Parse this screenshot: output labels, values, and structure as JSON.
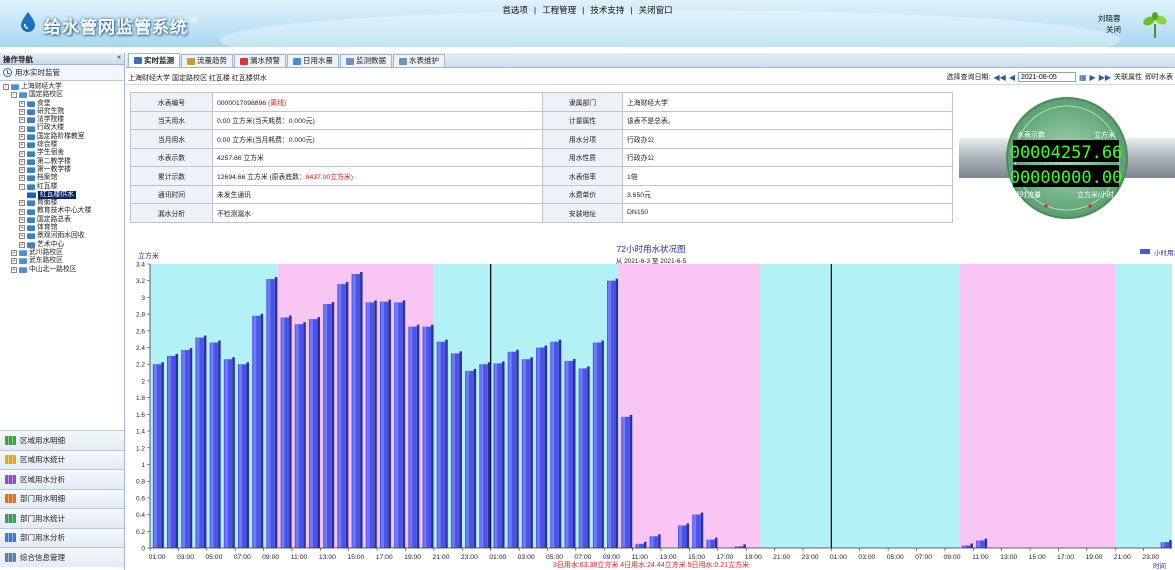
{
  "header": {
    "title": "给水管网监管系统",
    "subtitle": "v2011版",
    "user": "刘晓蓉",
    "logout": "关闭",
    "nav": [
      "首选项",
      "工程管理",
      "技术支持",
      "关闭窗口"
    ],
    "nav_sep": "|"
  },
  "sidebar": {
    "title": "操作导航",
    "collapse": "«",
    "monitor": "用水实时监管",
    "tree": [
      {
        "label": "上海财经大学",
        "level": 0,
        "pm": "⊟",
        "folder": "b"
      },
      {
        "label": "国定路校区",
        "level": 1,
        "pm": "⊟",
        "folder": "b"
      },
      {
        "label": "食堂",
        "level": 2,
        "pm": "⊞",
        "folder": "f"
      },
      {
        "label": "研究生院",
        "level": 2,
        "pm": "⊞",
        "folder": "f"
      },
      {
        "label": "法学院楼",
        "level": 2,
        "pm": "⊞",
        "folder": "f"
      },
      {
        "label": "行政大楼",
        "level": 2,
        "pm": "⊞",
        "folder": "f"
      },
      {
        "label": "国定路阶梯教室",
        "level": 2,
        "pm": "⊞",
        "folder": "f"
      },
      {
        "label": "综合楼",
        "level": 2,
        "pm": "⊞",
        "folder": "f"
      },
      {
        "label": "学生宿舍",
        "level": 2,
        "pm": "⊞",
        "folder": "f"
      },
      {
        "label": "第二教学楼",
        "level": 2,
        "pm": "⊞",
        "folder": "f"
      },
      {
        "label": "第一教学楼",
        "level": 2,
        "pm": "⊞",
        "folder": "f"
      },
      {
        "label": "档案馆",
        "level": 2,
        "pm": "⊞",
        "folder": "f"
      },
      {
        "label": "红瓦楼",
        "level": 2,
        "pm": "⊟",
        "folder": "f"
      },
      {
        "label": "红瓦楼供水",
        "level": 3,
        "pm": "",
        "folder": "m",
        "selected": true
      },
      {
        "label": "育衡楼",
        "level": 2,
        "pm": "⊞",
        "folder": "f"
      },
      {
        "label": "教育技术中心大楼",
        "level": 2,
        "pm": "⊞",
        "folder": "f"
      },
      {
        "label": "国定路总表",
        "level": 2,
        "pm": "⊞",
        "folder": "f"
      },
      {
        "label": "体育馆",
        "level": 2,
        "pm": "⊞",
        "folder": "f"
      },
      {
        "label": "景观河雨水回收",
        "level": 2,
        "pm": "⊞",
        "folder": "f"
      },
      {
        "label": "艺术中心",
        "level": 2,
        "pm": "⊞",
        "folder": "f"
      },
      {
        "label": "武川路校区",
        "level": 1,
        "pm": "⊞",
        "folder": "b"
      },
      {
        "label": "武东路校区",
        "level": 1,
        "pm": "⊞",
        "folder": "b"
      },
      {
        "label": "中山北一路校区",
        "level": 1,
        "pm": "⊞",
        "folder": "b"
      }
    ],
    "menu": [
      {
        "label": "区域用水明细",
        "icon": "bar-chart-green-icon",
        "color": "#3aa43a"
      },
      {
        "label": "区域用水统计",
        "icon": "bar-chart-yellow-icon",
        "color": "#e2a81a"
      },
      {
        "label": "区域用水分析",
        "icon": "bar-chart-purple-icon",
        "color": "#8a4fc4"
      },
      {
        "label": "部门用水明细",
        "icon": "org-orange-icon",
        "color": "#e07020"
      },
      {
        "label": "部门用水统计",
        "icon": "org-green-icon",
        "color": "#3a9a5a"
      },
      {
        "label": "部门用水分析",
        "icon": "org-blue-icon",
        "color": "#3a7ad0"
      },
      {
        "label": "综合信息管理",
        "icon": "document-icon",
        "color": "#5a7ab0"
      }
    ]
  },
  "tabs": [
    {
      "label": "实时监测",
      "icon": "monitor-icon",
      "color": "#3b6fb8",
      "active": true
    },
    {
      "label": "流量趋势",
      "icon": "trend-icon",
      "color": "#c8a030"
    },
    {
      "label": "漏水预警",
      "icon": "alert-icon",
      "color": "#e03030"
    },
    {
      "label": "日用水量",
      "icon": "calendar-icon",
      "color": "#4a8ad8"
    },
    {
      "label": "监测数据",
      "icon": "pencil-icon",
      "color": "#6a90c0"
    },
    {
      "label": "水表维护",
      "icon": "wrench-icon",
      "color": "#7090b0"
    }
  ],
  "breadcrumb": "上海财经大学 国定路校区 红瓦楼 红瓦楼供水",
  "query": {
    "label": "选择查询日期:",
    "date": "2021-06-05",
    "first": "◀◀",
    "prev": "◀",
    "next": "▶",
    "last": "▶▶",
    "related": "关联属性",
    "refresh": "即时水表"
  },
  "info": {
    "rows": [
      {
        "l1": "水表编号",
        "v1a": "0000017098896 ",
        "v1b": "(离线)",
        "l2": "隶属部门",
        "v2": "上海财经大学"
      },
      {
        "l1": "当天用水",
        "v1a": "0.00 立方米(当天耗费：0.000元)",
        "v1b": "",
        "l2": "计量属性",
        "v2": "该表不是总表。"
      },
      {
        "l1": "当月用水",
        "v1a": "0.00 立方米(当月耗费：0.000元)",
        "v1b": "",
        "l2": "用水分项",
        "v2": "行政办公"
      },
      {
        "l1": "水表示数",
        "v1a": "4257.66 立方米",
        "v1b": "",
        "l2": "用水性质",
        "v2": "行政办公"
      },
      {
        "l1": "累计示数",
        "v1a": "12694.66 立方米 (原表底数：",
        "v1b": "8437.00立方米)",
        "l2": "水表倍率",
        "v2": "1倍"
      },
      {
        "l1": "通讯时间",
        "v1a": "未发生通讯",
        "v1b": "",
        "l2": "水费单价",
        "v2": "3.650元"
      },
      {
        "l1": "漏水分析",
        "v1a": "不检测漏水",
        "v1b": "",
        "l2": "安装地址",
        "v2": "DN150"
      }
    ]
  },
  "meter": {
    "reading_label": "水表示数",
    "reading_unit": "立方米",
    "reading": "00004257.66",
    "flow_label": "瞬时流量",
    "flow_unit": "立方米/小时",
    "flow": "00000000.00"
  },
  "chart_data": {
    "type": "bar",
    "title": "72小时用水状况图",
    "subtitle": "从 2021-6-3 至 2021-6-5",
    "ylabel": "立方米",
    "xlabel": "时间",
    "legend": "小时用水量",
    "legend_position": "top-right",
    "ylim": [
      0,
      3.4
    ],
    "yticks": [
      0,
      0.2,
      0.4,
      0.6,
      0.8,
      1,
      1.2,
      1.4,
      1.6,
      1.8,
      2,
      2.2,
      2.4,
      2.6,
      2.8,
      3,
      3.2,
      3.4
    ],
    "ytick_labels": [
      "0",
      "0.2",
      "0.4",
      "0.6",
      "0.8",
      "1",
      "1.2",
      "1.4",
      "1.6",
      "1.8",
      "2",
      "2.2",
      "2.4",
      "2.6",
      "2.8",
      "3",
      "3.2",
      "3.4"
    ],
    "xtick_labels": [
      "01:00",
      "03:00",
      "05:00",
      "07:00",
      "09:00",
      "11:00",
      "13:00",
      "15:00",
      "17:00",
      "19:00",
      "21:00",
      "23:00",
      "01:00",
      "03:00",
      "05:00",
      "07:00",
      "09:00",
      "11:00",
      "13:00",
      "15:00",
      "17:00",
      "19:00",
      "21:00",
      "23:00",
      "01:00",
      "03:00",
      "05:00",
      "07:00",
      "09:00",
      "11:00",
      "13:00",
      "15:00",
      "17:00",
      "19:00",
      "21:00",
      "23:00"
    ],
    "values": [
      2.2,
      2.3,
      2.37,
      2.52,
      2.46,
      2.26,
      2.2,
      2.78,
      3.22,
      2.76,
      2.68,
      2.74,
      2.92,
      3.16,
      3.28,
      2.94,
      2.95,
      2.94,
      2.65,
      2.65,
      2.47,
      2.33,
      2.12,
      2.2,
      2.21,
      2.35,
      2.26,
      2.4,
      2.47,
      2.24,
      2.15,
      2.46,
      3.2,
      1.57,
      0.05,
      0.14,
      0,
      0.27,
      0.4,
      0.1,
      0,
      0.02,
      0,
      0,
      0,
      0,
      0,
      0,
      0,
      0,
      0,
      0,
      0,
      0,
      0,
      0,
      0,
      0.03,
      0.09,
      0,
      0,
      0,
      0,
      0,
      0,
      0,
      0,
      0,
      0,
      0,
      0,
      0.07
    ],
    "bands": [
      [
        "#b3f2f4",
        0,
        9
      ],
      [
        "#f9c6f4",
        9,
        20
      ],
      [
        "#b3f2f4",
        20,
        24
      ],
      [
        "#b3f2f4",
        24,
        33
      ],
      [
        "#f9c6f4",
        33,
        43
      ],
      [
        "#b3f2f4",
        43,
        48
      ],
      [
        "#b3f2f4",
        48,
        57
      ],
      [
        "#f9c6f4",
        57,
        68
      ],
      [
        "#b3f2f4",
        68,
        72
      ]
    ],
    "summary": "3日用水:63.38立方米 4日用水:24.44立方米 5日用水:0.21立方米",
    "bar_color": "#4a55e8"
  }
}
